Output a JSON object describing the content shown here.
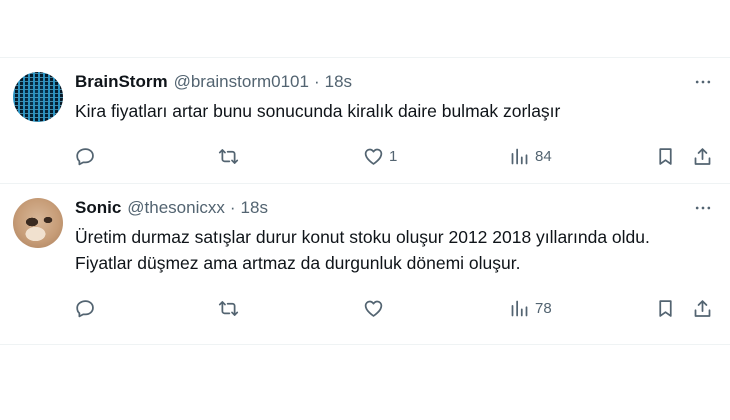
{
  "tweets": [
    {
      "display_name": "BrainStorm",
      "handle": "@brainstorm0101",
      "separator": "·",
      "time": "18s",
      "text_lines": [
        "Kira fiyatları artar bunu sonucunda kiralık daire bulmak zorlaşır"
      ],
      "actions": {
        "replies": "",
        "retweets": "",
        "likes": "1",
        "views": "84"
      }
    },
    {
      "display_name": "Sonic",
      "handle": "@thesonicxx",
      "separator": "·",
      "time": "18s",
      "text_lines": [
        "Üretim durmaz satışlar durur konut stoku oluşur 2012 2018 yıllarında oldu.",
        "Fiyatlar düşmez ama artmaz da durgunluk dönemi oluşur."
      ],
      "actions": {
        "replies": "",
        "retweets": "",
        "likes": "",
        "views": "78"
      }
    }
  ],
  "icons": {
    "reply": "reply-icon",
    "retweet": "retweet-icon",
    "like": "like-icon",
    "views": "views-icon",
    "bookmark": "bookmark-icon",
    "share": "share-icon",
    "more": "more-icon"
  },
  "colors": {
    "text": "#0f1419",
    "muted": "#536471",
    "divider": "#eff3f4"
  }
}
